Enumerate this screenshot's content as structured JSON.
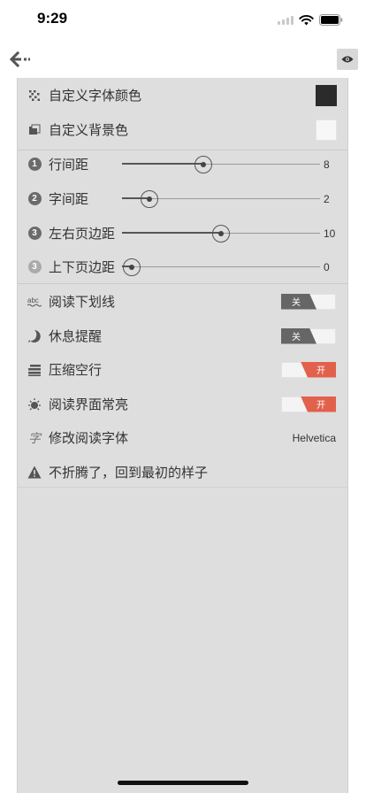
{
  "status": {
    "time": "9:29"
  },
  "nav": {
    "back_icon": "back-arrow-icon",
    "preview_icon": "eye-icon"
  },
  "colors": {
    "panel_bg": "#dedede",
    "font_color_swatch": "#2b2b2b",
    "background_swatch": "#f7f7f7",
    "toggle_on": "#e2614d",
    "toggle_off": "#666666"
  },
  "settings": {
    "font_color": {
      "label": "自定义字体颜色",
      "icon": "color-dots-icon"
    },
    "background_color": {
      "label": "自定义背景色",
      "icon": "background-fill-icon"
    },
    "line_spacing": {
      "label": "行间距",
      "index": "1",
      "value": "8",
      "fraction": 0.41
    },
    "letter_spacing": {
      "label": "字间距",
      "index": "2",
      "value": "2",
      "fraction": 0.14
    },
    "horizontal_margin": {
      "label": "左右页边距",
      "index": "3",
      "value": "10",
      "fraction": 0.5
    },
    "vertical_margin": {
      "label": "上下页边距",
      "index": "3",
      "value": "0",
      "fraction": 0.05
    },
    "underline": {
      "label": "阅读下划线",
      "icon": "abc-underline-icon",
      "state_label": "关",
      "on": false
    },
    "rest_reminder": {
      "label": "休息提醒",
      "icon": "rest-reminder-icon",
      "state_label": "关",
      "on": false
    },
    "compress_blank": {
      "label": "压缩空行",
      "icon": "compress-lines-icon",
      "state_label": "开",
      "on": true
    },
    "keep_screen_on": {
      "label": "阅读界面常亮",
      "icon": "sun-icon",
      "state_label": "开",
      "on": true
    },
    "reading_font": {
      "label": "修改阅读字体",
      "icon": "font-char-icon",
      "icon_char": "字",
      "value": "Helvetica"
    },
    "reset": {
      "label": "不折腾了，回到最初的样子",
      "icon": "warning-icon"
    }
  }
}
